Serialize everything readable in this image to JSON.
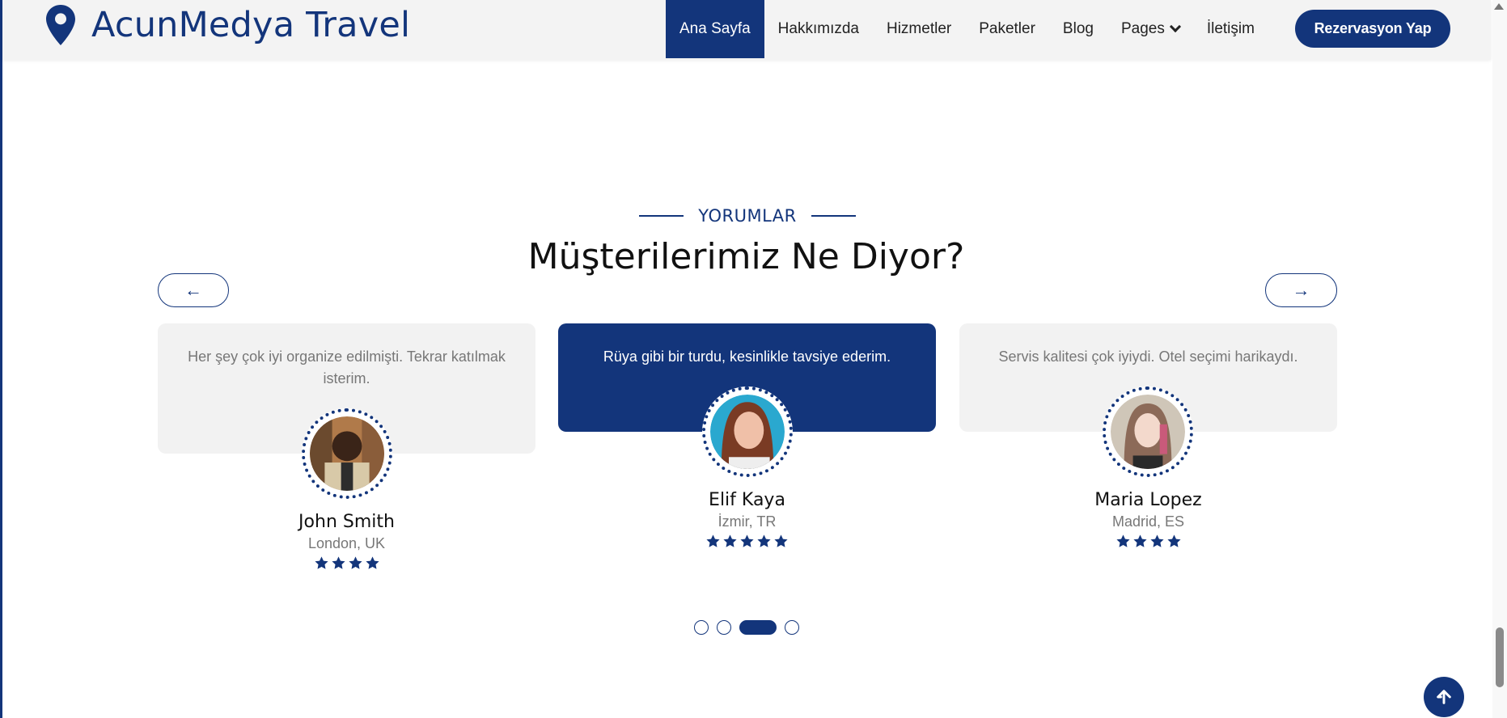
{
  "brand": {
    "name": "AcunMedya Travel",
    "icon": "map-pin-icon"
  },
  "nav": {
    "items": [
      {
        "label": "Ana Sayfa",
        "active": true
      },
      {
        "label": "Hakkımızda",
        "active": false
      },
      {
        "label": "Hizmetler",
        "active": false
      },
      {
        "label": "Paketler",
        "active": false
      },
      {
        "label": "Blog",
        "active": false
      },
      {
        "label": "Pages",
        "active": false,
        "dropdown": true
      },
      {
        "label": "İletişim",
        "active": false
      }
    ],
    "cta_label": "Rezervasyon Yap"
  },
  "section": {
    "eyebrow": "YORUMLAR",
    "title": "Müşterilerimiz Ne Diyor?"
  },
  "carousel": {
    "prev_icon": "arrow-left-icon",
    "next_icon": "arrow-right-icon",
    "prev_glyph": "←",
    "next_glyph": "→",
    "testimonials": [
      {
        "quote": "Her şey çok iyi organize edilmişti. Tekrar katılmak isterim.",
        "name": "John Smith",
        "location": "London, UK",
        "rating": 4,
        "featured": false
      },
      {
        "quote": "Rüya gibi bir turdu, kesinlikle tavsiye ederim.",
        "name": "Elif Kaya",
        "location": "İzmir, TR",
        "rating": 5,
        "featured": true
      },
      {
        "quote": "Servis kalitesi çok iyiydi. Otel seçimi harikaydı.",
        "name": "Maria Lopez",
        "location": "Madrid, ES",
        "rating": 4,
        "featured": false
      }
    ],
    "page_count": 4,
    "active_page": 3
  },
  "colors": {
    "primary": "#13357B",
    "card_bg": "#f2f2f2",
    "nav_bg": "#f3f3f3"
  }
}
